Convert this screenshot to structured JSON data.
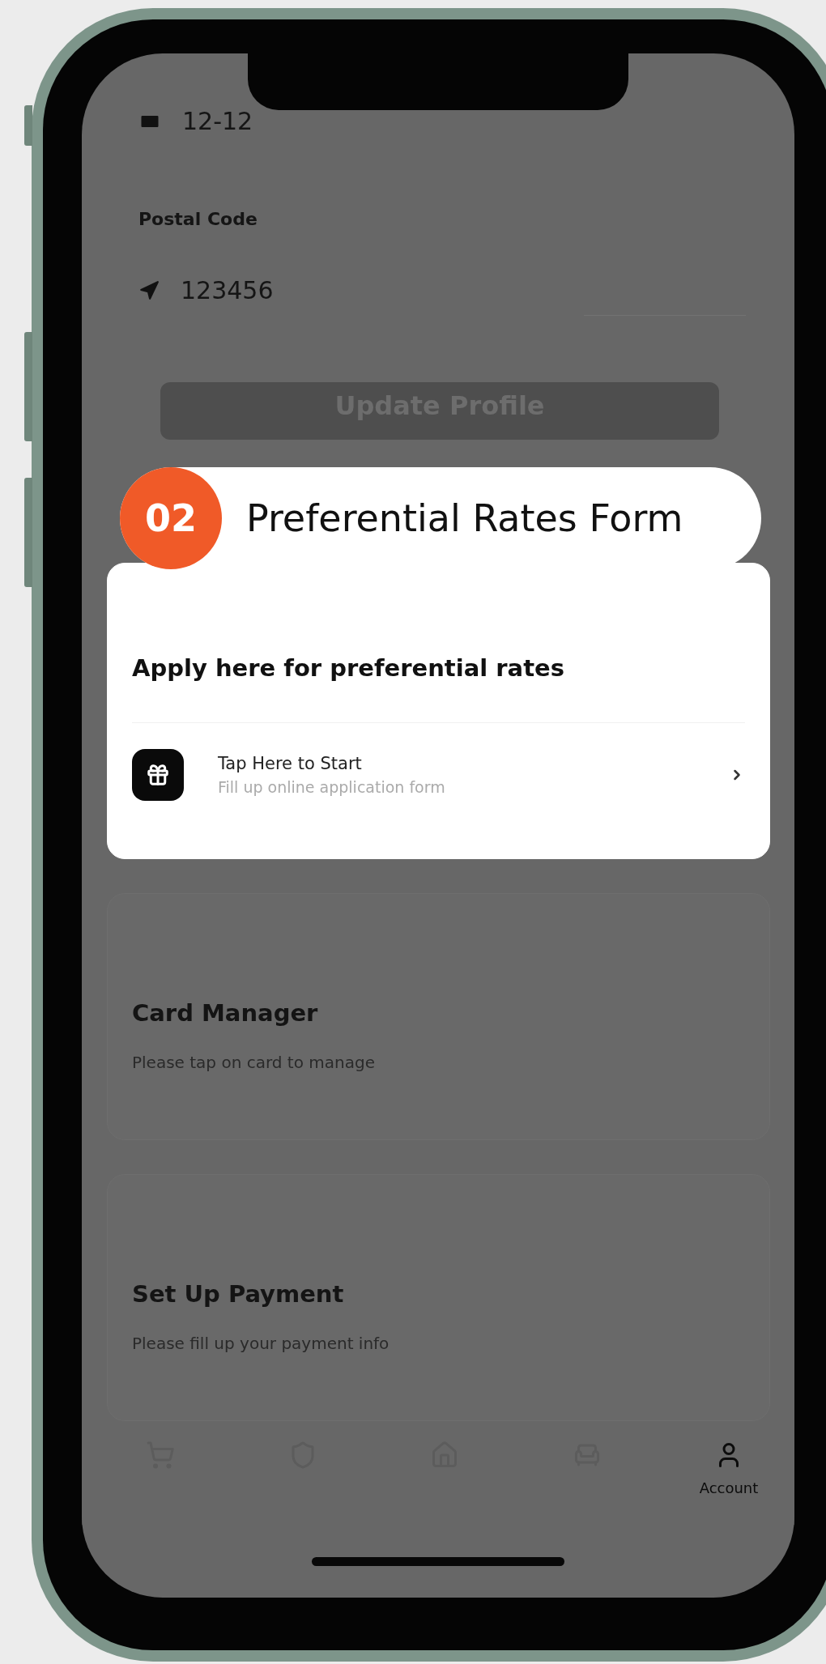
{
  "address": {
    "unit_value": "12-12",
    "postal_label": "Postal Code",
    "postal_value": "123456"
  },
  "update_button": "Update Profile",
  "callout": {
    "number": "02",
    "title": "Preferential Rates Form"
  },
  "sections": [
    {
      "title": "Apply here for preferential rates",
      "highlighted": true,
      "action": {
        "title": "Tap Here to Start",
        "subtitle": "Fill up online application form"
      }
    },
    {
      "title": "Card Manager",
      "highlighted": false,
      "subtitle": "Please tap on card to manage"
    },
    {
      "title": "Set Up Payment",
      "highlighted": false,
      "subtitle": "Please fill up your payment info"
    }
  ],
  "nav": [
    {
      "kind": "cart",
      "selected": false
    },
    {
      "kind": "shield",
      "selected": false
    },
    {
      "kind": "house",
      "selected": false
    },
    {
      "kind": "chair",
      "selected": false
    },
    {
      "kind": "user",
      "label": "Account",
      "selected": true
    }
  ]
}
